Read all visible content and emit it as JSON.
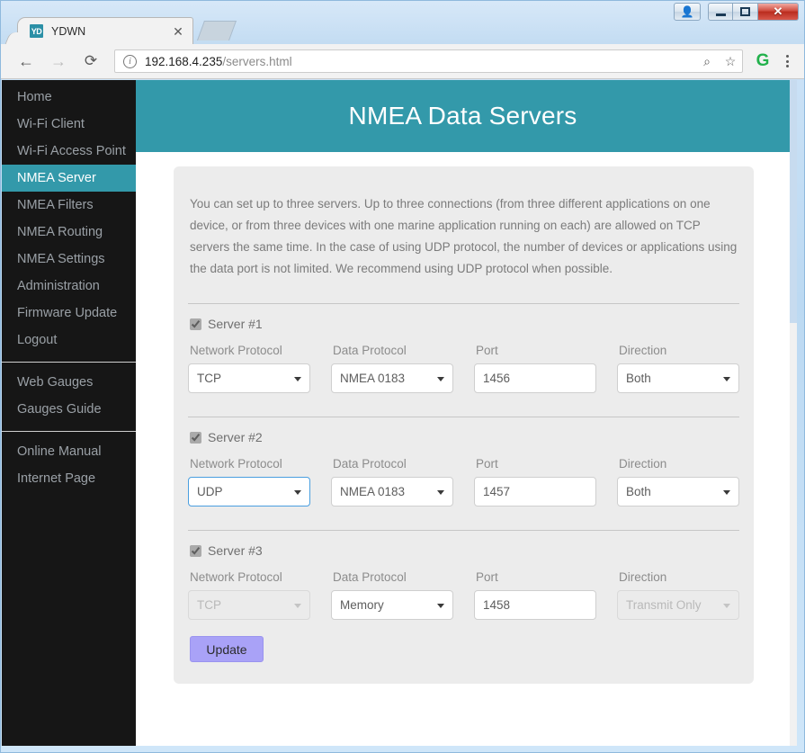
{
  "window": {
    "controls": {
      "user_label": "♟",
      "minimize_label": "",
      "maximize_label": "",
      "close_label": "✕"
    }
  },
  "browser": {
    "tab": {
      "favicon_text": "YD",
      "title": "YDWN",
      "close_label": "✕"
    },
    "new_tab_label": "",
    "nav": {
      "back_label": "←",
      "forward_label": "→",
      "reload_label": "⟳"
    },
    "omnibox": {
      "info_icon_label": "i",
      "url_host": "192.168.4.235",
      "url_path": "/servers.html",
      "zoom_icon_label": "⌕",
      "bookmark_icon_label": "☆"
    },
    "extension_icon_label": "G",
    "menu_icon_label": "⋮"
  },
  "sidebar": {
    "groups": [
      {
        "items": [
          {
            "label": "Home",
            "active": false
          },
          {
            "label": "Wi-Fi Client",
            "active": false
          },
          {
            "label": "Wi-Fi Access Point",
            "active": false
          },
          {
            "label": "NMEA Server",
            "active": true
          },
          {
            "label": "NMEA Filters",
            "active": false
          },
          {
            "label": "NMEA Routing",
            "active": false
          },
          {
            "label": "NMEA Settings",
            "active": false
          },
          {
            "label": "Administration",
            "active": false
          },
          {
            "label": "Firmware Update",
            "active": false
          },
          {
            "label": "Logout",
            "active": false
          }
        ]
      },
      {
        "items": [
          {
            "label": "Web Gauges",
            "active": false
          },
          {
            "label": "Gauges Guide",
            "active": false
          }
        ]
      },
      {
        "items": [
          {
            "label": "Online Manual",
            "active": false
          },
          {
            "label": "Internet Page",
            "active": false
          }
        ]
      }
    ]
  },
  "page": {
    "title": "NMEA Data Servers",
    "intro": "You can set up to three servers. Up to three connections (from three different applications on one device, or from three devices with one marine application running on each) are allowed on TCP servers the same time. In the case of using UDP protocol, the number of devices or applications using the data port is not limited. We recommend using UDP protocol when possible.",
    "column_labels": {
      "network_protocol": "Network Protocol",
      "data_protocol": "Data Protocol",
      "port": "Port",
      "direction": "Direction"
    },
    "servers": [
      {
        "label": "Server #1",
        "enabled": true,
        "network_protocol": {
          "value": "TCP",
          "disabled": false,
          "focused": false
        },
        "data_protocol": {
          "value": "NMEA 0183",
          "disabled": false,
          "focused": false
        },
        "port": {
          "value": "1456",
          "disabled": false,
          "focused": false
        },
        "direction": {
          "value": "Both",
          "disabled": false,
          "focused": false
        }
      },
      {
        "label": "Server #2",
        "enabled": true,
        "network_protocol": {
          "value": "UDP",
          "disabled": false,
          "focused": true
        },
        "data_protocol": {
          "value": "NMEA 0183",
          "disabled": false,
          "focused": false
        },
        "port": {
          "value": "1457",
          "disabled": false,
          "focused": false
        },
        "direction": {
          "value": "Both",
          "disabled": false,
          "focused": false
        }
      },
      {
        "label": "Server #3",
        "enabled": true,
        "network_protocol": {
          "value": "TCP",
          "disabled": true,
          "focused": false
        },
        "data_protocol": {
          "value": "Memory",
          "disabled": false,
          "focused": false
        },
        "port": {
          "value": "1458",
          "disabled": false,
          "focused": false
        },
        "direction": {
          "value": "Transmit Only",
          "disabled": true,
          "focused": false
        }
      }
    ],
    "update_button_label": "Update"
  },
  "colors": {
    "accent_teal": "#3399aa",
    "sidebar_bg": "#161616",
    "card_bg": "#ececec",
    "update_button": "#a9a2f7",
    "focus_border": "#4a9fe0"
  }
}
